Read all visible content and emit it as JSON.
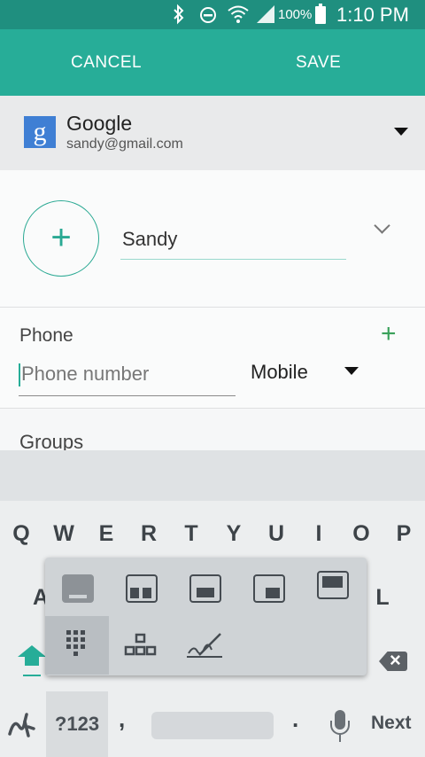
{
  "status_bar": {
    "battery_percent": "100%",
    "time": "1:10 PM",
    "icons": [
      "bluetooth-icon",
      "do-not-disturb-icon",
      "wifi-icon",
      "signal-icon",
      "battery-icon"
    ]
  },
  "action_bar": {
    "cancel_label": "CANCEL",
    "save_label": "SAVE"
  },
  "account": {
    "logo_letter": "g",
    "name": "Google",
    "email": "sandy@gmail.com"
  },
  "contact": {
    "name_value": "Sandy"
  },
  "phone": {
    "label": "Phone",
    "placeholder": "Phone number",
    "type": "Mobile"
  },
  "groups": {
    "label": "Groups"
  },
  "keyboard": {
    "row1": [
      "Q",
      "W",
      "E",
      "R",
      "T",
      "Y",
      "U",
      "I",
      "O",
      "P"
    ],
    "left_partial_key": "A",
    "right_partial_key": "L",
    "symbols_key": "?123",
    "comma": ",",
    "period": ".",
    "next_key": "Next",
    "popup_modes": [
      "keyboard-standard-icon",
      "keyboard-split-left-icon",
      "keyboard-center-icon",
      "keyboard-split-right-icon",
      "keyboard-floating-icon",
      "keypad-icon",
      "keyboard-layout-icon",
      "handwriting-icon"
    ]
  },
  "colors": {
    "status_bar": "#1f8f7f",
    "action_bar": "#27ad98",
    "accent": "#2aa993",
    "add_green": "#3aa15a"
  }
}
